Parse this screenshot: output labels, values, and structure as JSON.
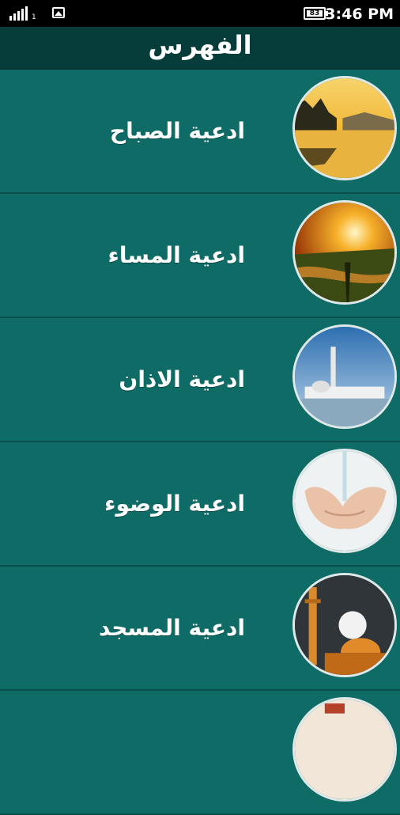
{
  "status_bar": {
    "signal_sub": "1",
    "battery": "83",
    "time": "3:46 PM"
  },
  "header": {
    "title": "الفهرس"
  },
  "items": [
    {
      "label": "ادعية الصباح",
      "icon": "morning-lake-icon"
    },
    {
      "label": "ادعية المساء",
      "icon": "sunset-icon"
    },
    {
      "label": "ادعية الاذان",
      "icon": "mosque-minaret-icon"
    },
    {
      "label": "ادعية الوضوء",
      "icon": "ablution-hands-icon"
    },
    {
      "label": "ادعية المسجد",
      "icon": "mosque-night-icon"
    }
  ]
}
